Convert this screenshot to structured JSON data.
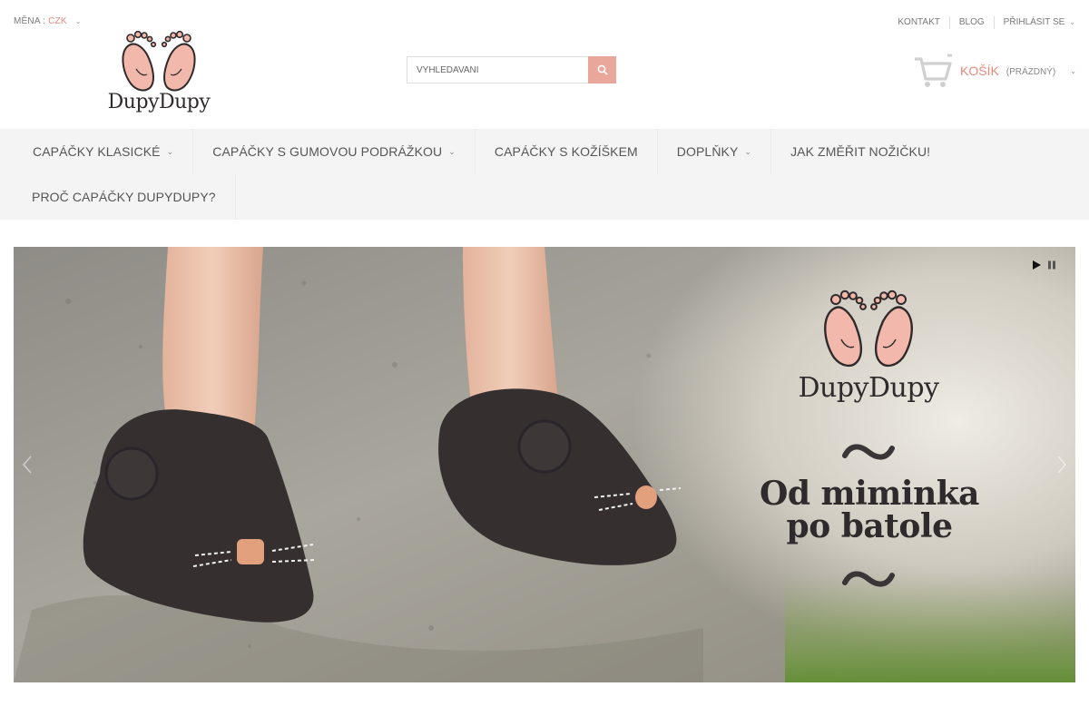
{
  "topbar": {
    "currency_label": "MĚNA :",
    "currency_value": "CZK",
    "links": [
      "KONTAKT",
      "BLOG",
      "PŘIHLÁSIT SE"
    ]
  },
  "logo": {
    "text": "DupyDupy"
  },
  "search": {
    "placeholder": "VYHLEDAVANI"
  },
  "cart": {
    "label": "KOŠÍK",
    "state": "(PRÁZDNÝ)"
  },
  "nav": {
    "row1": [
      {
        "label": "CAPÁČKY KLASICKÉ",
        "dropdown": true
      },
      {
        "label": "CAPÁČKY S GUMOVOU PODRÁŽKOU",
        "dropdown": true
      },
      {
        "label": "CAPÁČKY S KOŽÍŠKEM",
        "dropdown": false
      },
      {
        "label": "DOPLŇKY",
        "dropdown": true
      },
      {
        "label": "JAK ZMĚŘIT NOŽIČKU!",
        "dropdown": false
      }
    ],
    "row2": [
      {
        "label": "PROČ CAPÁČKY DUPYDUPY?",
        "dropdown": false
      }
    ]
  },
  "slider": {
    "brand": "DupyDupy",
    "tagline_line1": "Od miminka",
    "tagline_line2": "po batole"
  },
  "colors": {
    "accent": "#e88a7d",
    "search_button": "#e9a79c",
    "nav_bg": "#f4f4f4",
    "feet": "#f2b8ac"
  },
  "icons": {
    "search": "search-icon",
    "cart": "cart-icon",
    "play": "play-icon",
    "pause": "pause-icon",
    "chevron": "chevron-down-icon"
  }
}
